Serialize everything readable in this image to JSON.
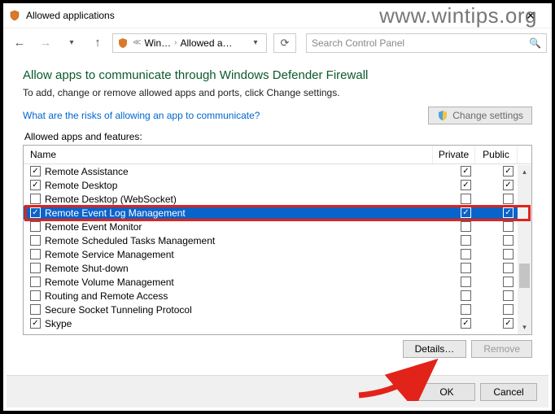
{
  "window": {
    "title": "Allowed applications"
  },
  "watermark": "www.wintips.org",
  "breadcrumb": {
    "seg1": "Win…",
    "seg2": "Allowed a…"
  },
  "search": {
    "placeholder": "Search Control Panel"
  },
  "heading": "Allow apps to communicate through Windows Defender Firewall",
  "subtext": "To add, change or remove allowed apps and ports, click Change settings.",
  "link": "What are the risks of allowing an app to communicate?",
  "change_settings": "Change settings",
  "list_label": "Allowed apps and features:",
  "columns": {
    "name": "Name",
    "private": "Private",
    "public": "Public"
  },
  "rows": [
    {
      "name": "Remote Assistance",
      "enabled": true,
      "private": true,
      "public": true,
      "selected": false
    },
    {
      "name": "Remote Desktop",
      "enabled": true,
      "private": true,
      "public": true,
      "selected": false
    },
    {
      "name": "Remote Desktop (WebSocket)",
      "enabled": false,
      "private": false,
      "public": false,
      "selected": false
    },
    {
      "name": "Remote Event Log Management",
      "enabled": true,
      "private": true,
      "public": true,
      "selected": true
    },
    {
      "name": "Remote Event Monitor",
      "enabled": false,
      "private": false,
      "public": false,
      "selected": false
    },
    {
      "name": "Remote Scheduled Tasks Management",
      "enabled": false,
      "private": false,
      "public": false,
      "selected": false
    },
    {
      "name": "Remote Service Management",
      "enabled": false,
      "private": false,
      "public": false,
      "selected": false
    },
    {
      "name": "Remote Shut-down",
      "enabled": false,
      "private": false,
      "public": false,
      "selected": false
    },
    {
      "name": "Remote Volume Management",
      "enabled": false,
      "private": false,
      "public": false,
      "selected": false
    },
    {
      "name": "Routing and Remote Access",
      "enabled": false,
      "private": false,
      "public": false,
      "selected": false
    },
    {
      "name": "Secure Socket Tunneling Protocol",
      "enabled": false,
      "private": false,
      "public": false,
      "selected": false
    },
    {
      "name": "Skype",
      "enabled": true,
      "private": true,
      "public": true,
      "selected": false
    }
  ],
  "buttons": {
    "details": "Details…",
    "remove": "Remove",
    "ok": "OK",
    "cancel": "Cancel"
  }
}
